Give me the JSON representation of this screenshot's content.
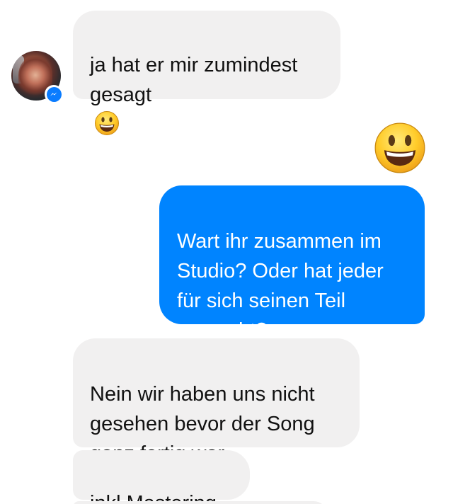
{
  "messages": [
    {
      "sender": "contact",
      "text": "ja hat er mir zumindest\ngesagt",
      "trailing_emoji": "grinning-face"
    },
    {
      "sender": "self",
      "emoji": "grinning-face"
    },
    {
      "sender": "self",
      "text": "Wart ihr zusammen im\nStudio? Oder hat jeder\nfür sich seinen Teil\ngemacht?"
    },
    {
      "sender": "contact",
      "text": "Nein wir haben uns nicht\ngesehen bevor der Song\nganz fertig war"
    },
    {
      "sender": "contact",
      "text": "inkl Mastering"
    }
  ],
  "colors": {
    "incoming_bubble": "#f1f0f0",
    "outgoing_bubble": "#0084ff",
    "messenger_blue": "#0a7cff"
  },
  "icons": {
    "avatar_badge": "messenger-icon",
    "emoji": "grinning-face-emoji"
  }
}
